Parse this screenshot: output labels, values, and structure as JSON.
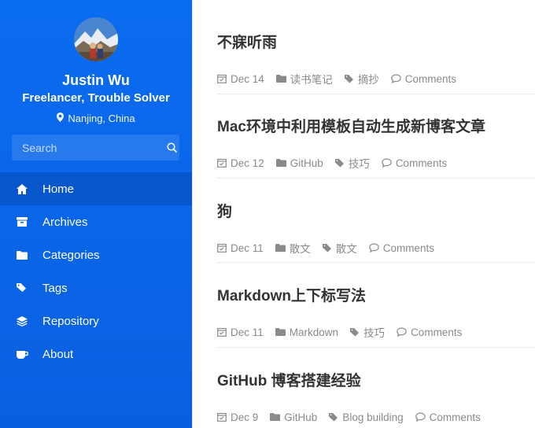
{
  "profile": {
    "name": "Justin Wu",
    "title": "Freelancer, Trouble Solver",
    "location": "Nanjing, China"
  },
  "search": {
    "placeholder": "Search"
  },
  "nav": {
    "items": [
      {
        "label": "Home",
        "icon": "home-icon",
        "active": true
      },
      {
        "label": "Archives",
        "icon": "archive-icon"
      },
      {
        "label": "Categories",
        "icon": "folder-icon"
      },
      {
        "label": "Tags",
        "icon": "tags-icon"
      },
      {
        "label": "Repository",
        "icon": "layers-icon"
      },
      {
        "label": "About",
        "icon": "coffee-icon"
      }
    ]
  },
  "posts": [
    {
      "title": "不寐听雨",
      "date": "Dec 14",
      "category": "读书笔记",
      "tag": "摘抄",
      "comments": "Comments"
    },
    {
      "title": "Mac环境中利用模板自动生成新博客文章",
      "date": "Dec 12",
      "category": "GitHub",
      "tag": "技巧",
      "comments": "Comments"
    },
    {
      "title": "狗",
      "date": "Dec 11",
      "category": "散文",
      "tag": "散文",
      "comments": "Comments"
    },
    {
      "title": "Markdown上下标写法",
      "date": "Dec 11",
      "category": "Markdown",
      "tag": "技巧",
      "comments": "Comments"
    },
    {
      "title": "GitHub 博客搭建经验",
      "date": "Dec 9",
      "category": "GitHub",
      "tag": "Blog building",
      "comments": "Comments"
    }
  ],
  "colors": {
    "sidebar": "#0a6cf0",
    "title_text": "#333333",
    "meta_text": "#8a8a8a"
  }
}
